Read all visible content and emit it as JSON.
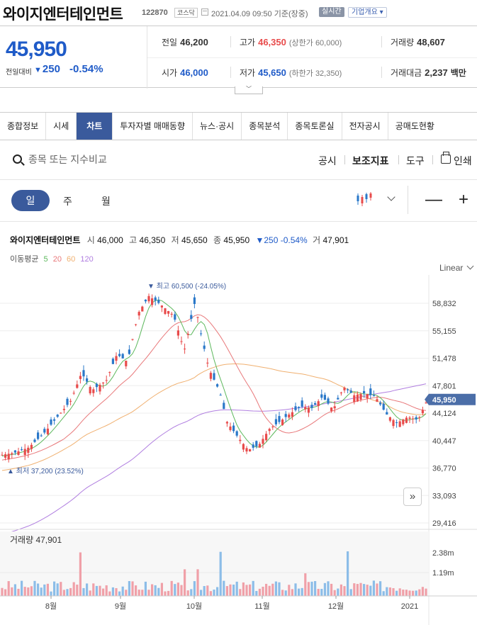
{
  "header": {
    "name": "와이지엔터테인먼트",
    "code": "122870",
    "market": "코스닥",
    "datetime": "2021.04.09 09:50",
    "basis": "기준(장중)",
    "realtime": "실시간",
    "company_info": "기업개요"
  },
  "quote": {
    "price": "45,950",
    "change_label": "전일대비",
    "change": "250",
    "change_pct": "-0.54%",
    "prev_label": "전일",
    "prev": "46,200",
    "high_label": "고가",
    "high": "46,350",
    "upper_label": "(상한가 60,000)",
    "volume_label": "거래량",
    "volume": "48,607",
    "open_label": "시가",
    "open": "46,000",
    "low_label": "저가",
    "low": "45,650",
    "lower_label": "(하한가 32,350)",
    "amount_label": "거래대금",
    "amount": "2,237",
    "amount_unit": "백만"
  },
  "tabs": [
    "종합정보",
    "시세",
    "차트",
    "투자자별 매매동향",
    "뉴스·공시",
    "종목분석",
    "종목토론실",
    "전자공시",
    "공매도현황"
  ],
  "toolbar": {
    "search_placeholder": "종목 또는 지수비교",
    "disclosure": "공시",
    "indicator": "보조지표",
    "tools": "도구",
    "print": "인쇄"
  },
  "periods": [
    "일",
    "주",
    "월"
  ],
  "zoom": {
    "out": "—",
    "in": "+"
  },
  "info": {
    "name": "와이지엔터테인먼트",
    "o_label": "시",
    "o": "46,000",
    "h_label": "고",
    "h": "46,350",
    "l_label": "저",
    "l": "45,650",
    "c_label": "종",
    "c": "45,950",
    "chg": "▼250 -0.54%",
    "v_label": "거",
    "v": "47,901"
  },
  "ma": {
    "label": "이동평균",
    "p5": "5",
    "p20": "20",
    "p60": "60",
    "p120": "120"
  },
  "scale": "Linear",
  "colors": {
    "up": "#e84b4b",
    "down": "#2a78c9",
    "ma5": "#5cb85c",
    "ma20": "#e8787a",
    "ma60": "#f0b070",
    "ma120": "#b07ee0",
    "accent": "#3a5a9c"
  },
  "chart_data": {
    "type": "candlestick",
    "price_ticks": [
      "58,832",
      "55,155",
      "51,478",
      "47,801",
      "44,124",
      "40,447",
      "36,770",
      "33,093",
      "29,416"
    ],
    "price_ylim": [
      29416,
      58832
    ],
    "current_price": "45,950",
    "max_annotation": "▼ 최고 60,500 (-24.05%)",
    "min_annotation": "▲ 최저 37,200 (23.52%)",
    "x_ticks": [
      "8월",
      "9월",
      "10월",
      "11월",
      "12월",
      "2021"
    ],
    "volume_label": "거래량",
    "volume_value": "47,901",
    "volume_ticks": [
      "2.38m",
      "1.19m"
    ]
  }
}
